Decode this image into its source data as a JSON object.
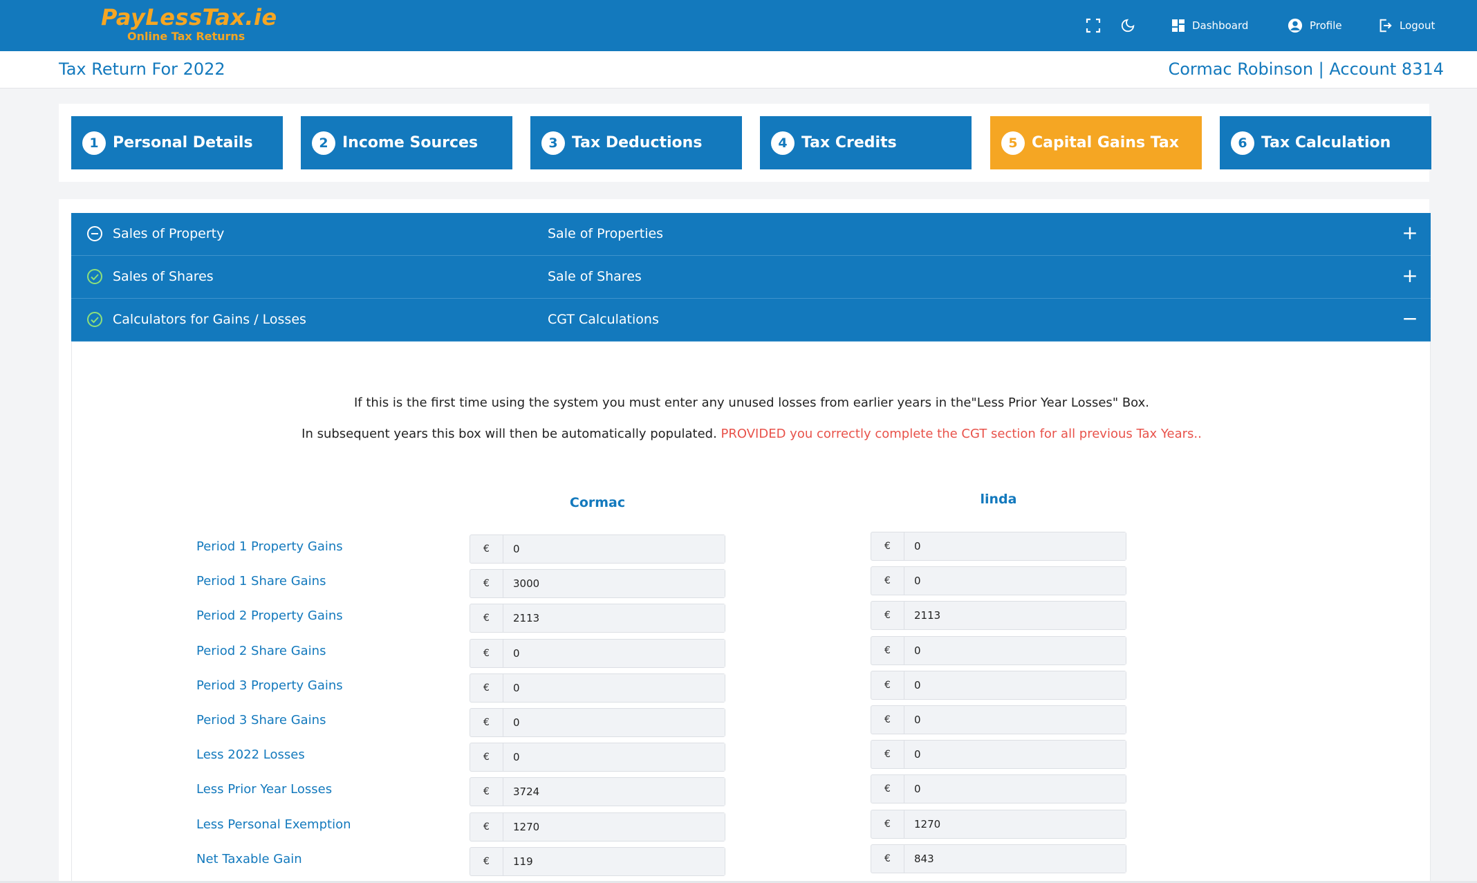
{
  "header": {
    "logo_main": "PayLessTax.ie",
    "logo_sub": "Online Tax Returns",
    "nav": {
      "dashboard": "Dashboard",
      "profile": "Profile",
      "logout": "Logout"
    },
    "colors": {
      "primary": "#1379bd",
      "accent": "#f5a623"
    }
  },
  "subheader": {
    "title": "Tax Return For 2022",
    "account": "Cormac Robinson | Account 8314"
  },
  "steps": [
    {
      "num": "1",
      "label": "Personal Details",
      "active": false
    },
    {
      "num": "2",
      "label": "Income Sources",
      "active": false
    },
    {
      "num": "3",
      "label": "Tax Deductions",
      "active": false
    },
    {
      "num": "4",
      "label": "Tax Credits",
      "active": false
    },
    {
      "num": "5",
      "label": "Capital Gains Tax",
      "active": true
    },
    {
      "num": "6",
      "label": "Tax Calculation",
      "active": false
    }
  ],
  "accordion": [
    {
      "left": "Sales of Property",
      "mid": "Sale of Properties",
      "icon": "minus-circle-icon",
      "toggle": "+"
    },
    {
      "left": "Sales of Shares",
      "mid": "Sale of Shares",
      "icon": "check-circle-icon",
      "toggle": "+"
    },
    {
      "left": "Calculators for Gains / Losses",
      "mid": "CGT Calculations",
      "icon": "check-circle-icon",
      "toggle": "−"
    }
  ],
  "calc": {
    "note1": "If this is the first time using the system you must enter any unused losses from earlier years in the\"Less Prior Year Losses\" Box.",
    "note2_plain": "In subsequent years this box will then be automatically populated. ",
    "note2_warn": "PROVIDED you correctly complete the CGT section for all previous Tax Years..",
    "currency": "€",
    "columns": [
      "Cormac",
      "linda"
    ],
    "rows": [
      {
        "label": "Period 1 Property Gains",
        "cormac": "0",
        "linda": "0"
      },
      {
        "label": "Period 1 Share Gains",
        "cormac": "3000",
        "linda": "0"
      },
      {
        "label": "Period 2 Property Gains",
        "cormac": "2113",
        "linda": "2113"
      },
      {
        "label": "Period 2 Share Gains",
        "cormac": "0",
        "linda": "0"
      },
      {
        "label": "Period 3 Property Gains",
        "cormac": "0",
        "linda": "0"
      },
      {
        "label": "Period 3 Share Gains",
        "cormac": "0",
        "linda": "0"
      },
      {
        "label": "Less 2022 Losses",
        "cormac": "0",
        "linda": "0"
      },
      {
        "label": "Less Prior Year Losses",
        "cormac": "3724",
        "linda": "0"
      },
      {
        "label": "Less Personal Exemption",
        "cormac": "1270",
        "linda": "1270"
      },
      {
        "label": "Net Taxable Gain",
        "cormac": "119",
        "linda": "843"
      }
    ]
  }
}
